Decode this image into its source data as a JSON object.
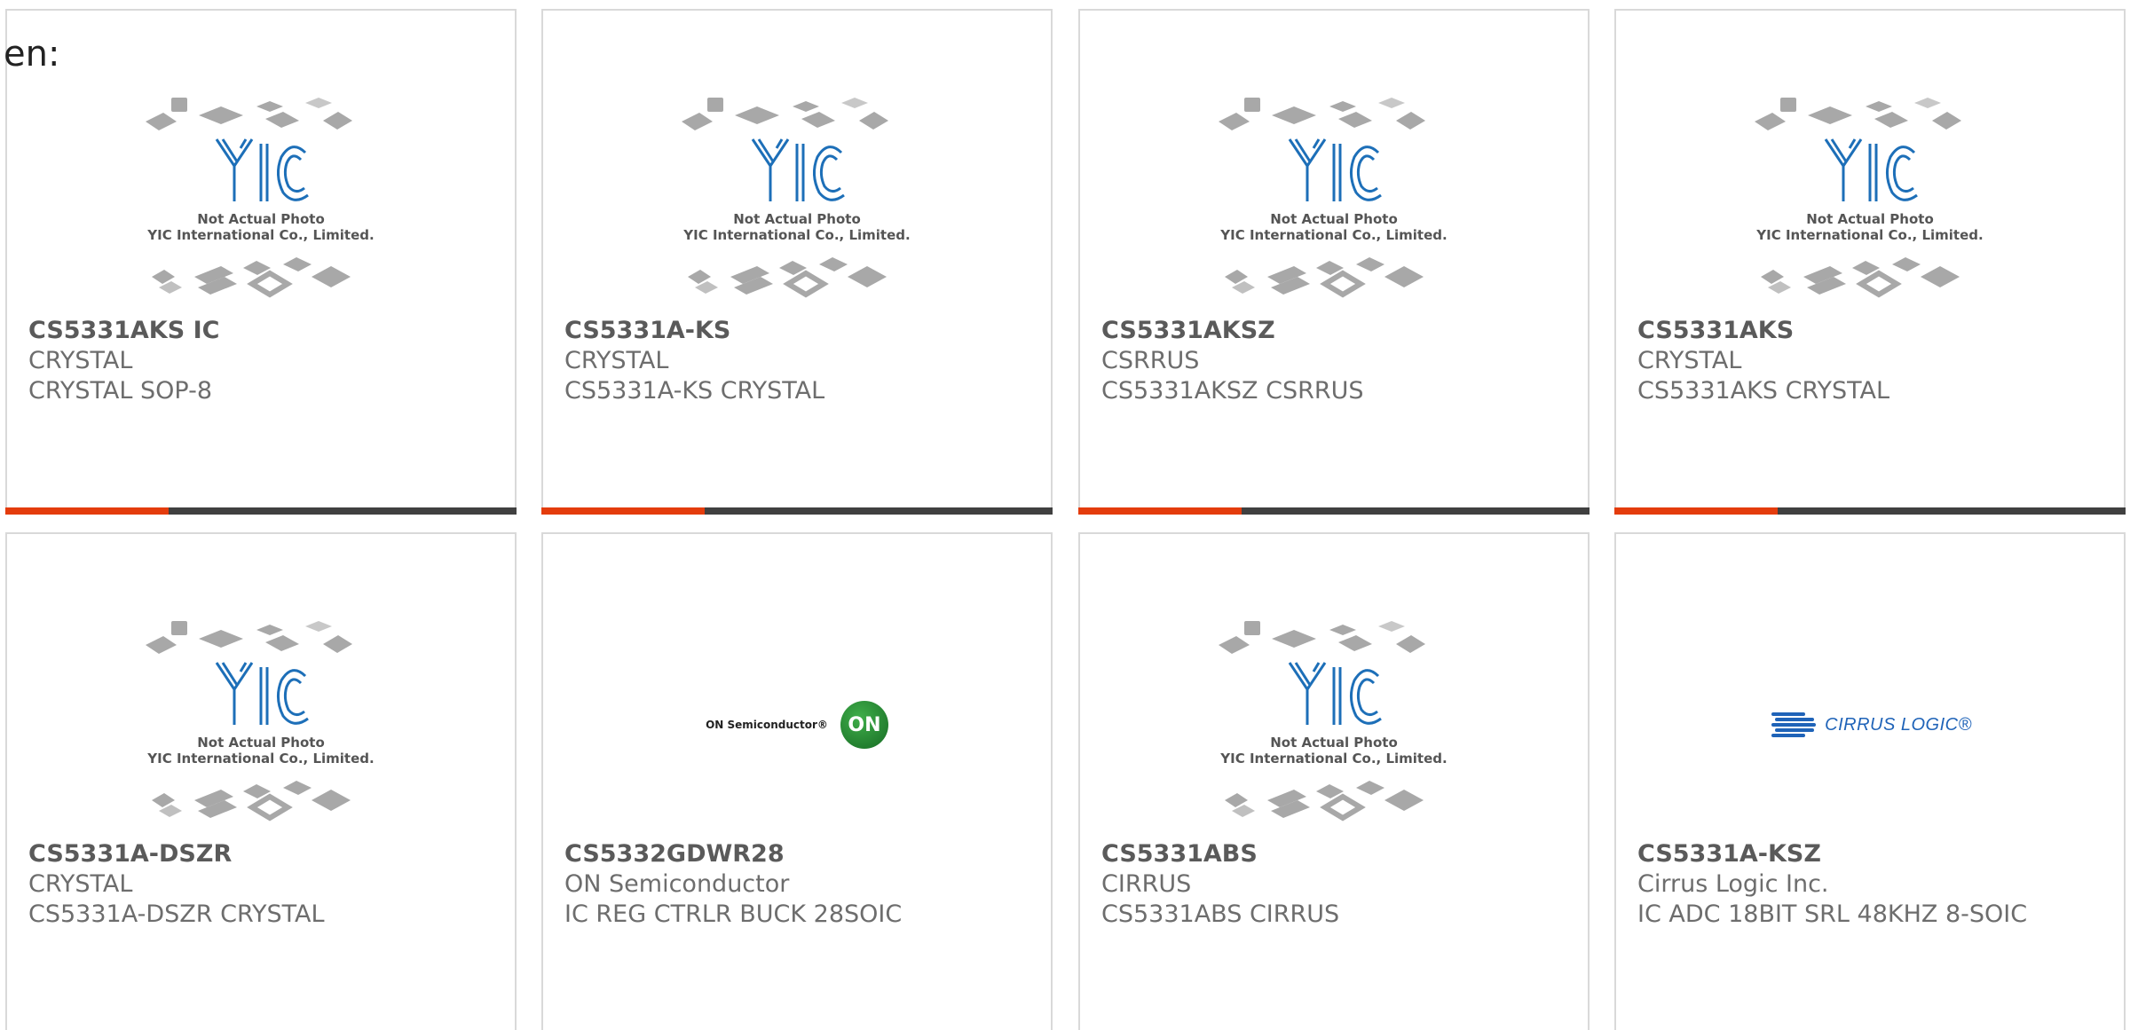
{
  "page": {
    "lang_label": "en:"
  },
  "placeholder": {
    "line1": "Not Actual Photo",
    "line2": "YIC International Co., Limited."
  },
  "logos": {
    "on_text": "ON Semiconductor®",
    "on_badge": "ON",
    "cirrus_text": "CIRRUS LOGIC®"
  },
  "products": [
    {
      "part": "CS5331AKS IC",
      "manufacturer": "CRYSTAL",
      "description": "CRYSTAL SOP-8",
      "image": "yic-placeholder"
    },
    {
      "part": "CS5331A-KS",
      "manufacturer": "CRYSTAL",
      "description": "CS5331A-KS CRYSTAL",
      "image": "yic-placeholder"
    },
    {
      "part": "CS5331AKSZ",
      "manufacturer": "CSRRUS",
      "description": "CS5331AKSZ CSRRUS",
      "image": "yic-placeholder"
    },
    {
      "part": "CS5331AKS",
      "manufacturer": "CRYSTAL",
      "description": "CS5331AKS CRYSTAL",
      "image": "yic-placeholder"
    },
    {
      "part": "CS5331A-DSZR",
      "manufacturer": "CRYSTAL",
      "description": "CS5331A-DSZR CRYSTAL",
      "image": "yic-placeholder"
    },
    {
      "part": "CS5332GDWR28",
      "manufacturer": "ON Semiconductor",
      "description": "IC REG CTRLR BUCK 28SOIC",
      "image": "on-semiconductor-logo"
    },
    {
      "part": "CS5331ABS",
      "manufacturer": "CIRRUS",
      "description": "CS5331ABS CIRRUS",
      "image": "yic-placeholder"
    },
    {
      "part": "CS5331A-KSZ",
      "manufacturer": "Cirrus Logic Inc.",
      "description": "IC ADC 18BIT SRL 48KHZ 8-SOIC",
      "image": "cirrus-logic-logo"
    }
  ],
  "colors": {
    "accent": "#e43c0c",
    "bar": "#404040",
    "border": "#d9d9d9",
    "text": "#6d6d6d",
    "yic_blue": "#1d6fb8"
  }
}
